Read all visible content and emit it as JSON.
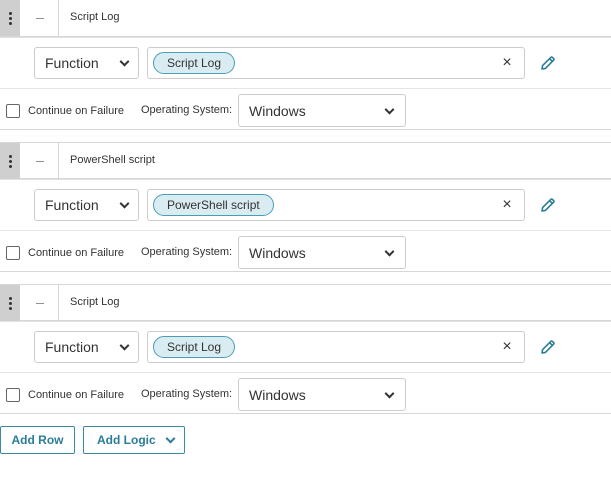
{
  "steps": [
    {
      "title": "Script Log",
      "type_value": "Function",
      "chip": "Script Log",
      "continue_label": "Continue on Failure",
      "os_label": "Operating System:",
      "os_value": "Windows"
    },
    {
      "title": "PowerShell script",
      "type_value": "Function",
      "chip": "PowerShell script",
      "continue_label": "Continue on Failure",
      "os_label": "Operating System:",
      "os_value": "Windows"
    },
    {
      "title": "Script Log",
      "type_value": "Function",
      "chip": "Script Log",
      "continue_label": "Continue on Failure",
      "os_label": "Operating System:",
      "os_value": "Windows"
    }
  ],
  "clear_glyph": "×",
  "footer": {
    "add_row": "Add Row",
    "add_logic": "Add Logic"
  },
  "icons": {
    "drag": "vertical-dots-icon",
    "collapse": "minus-icon",
    "edit": "pencil-icon",
    "clear": "close-icon",
    "dropdown": "chevron-down-icon"
  },
  "colors": {
    "accent": "#2a7d98",
    "chip_bg": "#d9ecf2",
    "chip_border": "#4a9db5",
    "handle_bg": "#cfcfcf"
  }
}
